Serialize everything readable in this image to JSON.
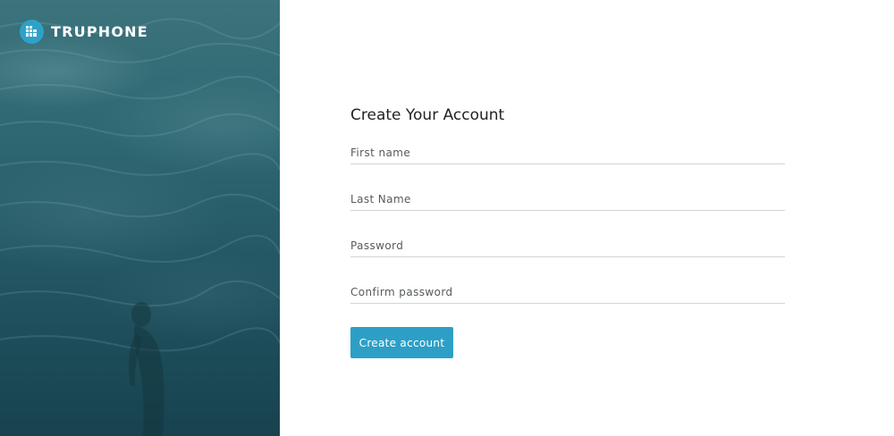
{
  "brand": {
    "name": "TRUPHONE",
    "logo_icon": "truphone-logo-icon",
    "logo_color": "#2da2c9"
  },
  "background_image": "underwater-swimmer-photo",
  "form": {
    "title": "Create Your Account",
    "fields": [
      {
        "placeholder": "First name",
        "value": ""
      },
      {
        "placeholder": "Last Name",
        "value": ""
      },
      {
        "placeholder": "Password",
        "value": ""
      },
      {
        "placeholder": "Confirm password",
        "value": ""
      }
    ],
    "submit_label": "Create account",
    "submit_color": "#2d9fc6"
  }
}
